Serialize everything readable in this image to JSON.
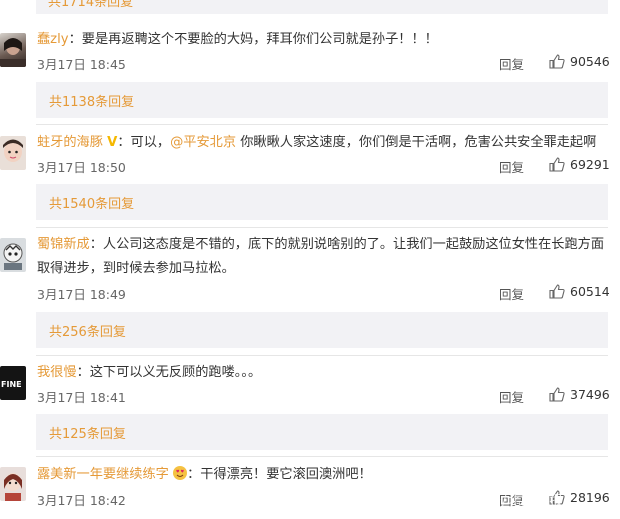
{
  "top_reply_partial": "共1714条回复",
  "comments": [
    {
      "user": "蠢zly",
      "text": "：要是再返聘这个不要脸的大妈，拜耳你们公司就是孙子！！！",
      "time": "3月17日 18:45",
      "reply_label": "回复",
      "likes": "90546",
      "replies": "共1138条回复"
    },
    {
      "user": "蛀牙的海豚",
      "text_pre": "：可以，",
      "mention": "@平安北京",
      "text_post": " 你瞅瞅人家这速度，你们倒是干活啊，危害公共安全罪走起啊",
      "time": "3月17日 18:50",
      "reply_label": "回复",
      "likes": "69291",
      "replies": "共1540条回复"
    },
    {
      "user": "蜀锦新成",
      "text_line1": "：人公司这态度是不错的，底下的就别说啥别的了。让我们一起鼓励这位女性在长跑方面",
      "text_line2": "取得进步，到时候去参加马拉松。",
      "time": "3月17日 18:49",
      "reply_label": "回复",
      "likes": "60514",
      "replies": "共256条回复"
    },
    {
      "user": "我很慢",
      "text": "：这下可以义无反顾的跑喽。。。",
      "time": "3月17日 18:41",
      "reply_label": "回复",
      "likes": "37496",
      "replies": "共125条回复"
    },
    {
      "user": "露美新一年要继续练字",
      "text": "：干得漂亮！要它滚回澳洲吧！",
      "time": "3月17日 18:42",
      "reply_label": "回复",
      "likes": "28196"
    }
  ],
  "watermark": "百家号/北京日报",
  "colors": {
    "link": "#e59a38",
    "bar_bg": "#f2f2f5",
    "vip": "#f5b800"
  }
}
